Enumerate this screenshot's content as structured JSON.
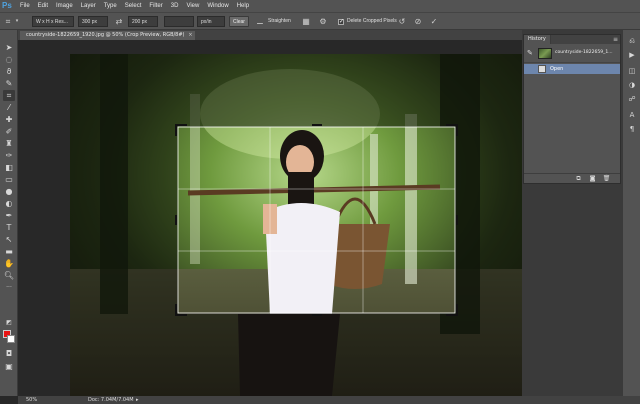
{
  "app": {
    "logo": "Ps",
    "menus": [
      "File",
      "Edit",
      "Image",
      "Layer",
      "Type",
      "Select",
      "Filter",
      "3D",
      "View",
      "Window",
      "Help"
    ]
  },
  "options": {
    "ratio_value": "W x H x Res...",
    "width_value": "300 px",
    "swap_icon": "swap-arrows-icon",
    "height_value": "200 px",
    "resolution_value": "",
    "resolution_unit": "px/in",
    "clear_label": "Clear",
    "straighten_label": "Straighten",
    "delete_cropped_label": "Delete Cropped Pixels",
    "delete_cropped_checked": true
  },
  "document": {
    "tab_label": "countryside-1822659_1920.jpg @ 50% (Crop Preview, RGB/8#)",
    "close_glyph": "×"
  },
  "status": {
    "zoom": "50%",
    "doc_info": "Doc: 7.04M/7.04M"
  },
  "history": {
    "tab_label": "History",
    "snapshot_label": "countryside-1822659_1...",
    "state_label": "Open"
  },
  "colors": {
    "foreground": "#e81212",
    "background": "#ffffff",
    "selected_state": "#6d86ad",
    "logo": "#4fa3e0"
  }
}
